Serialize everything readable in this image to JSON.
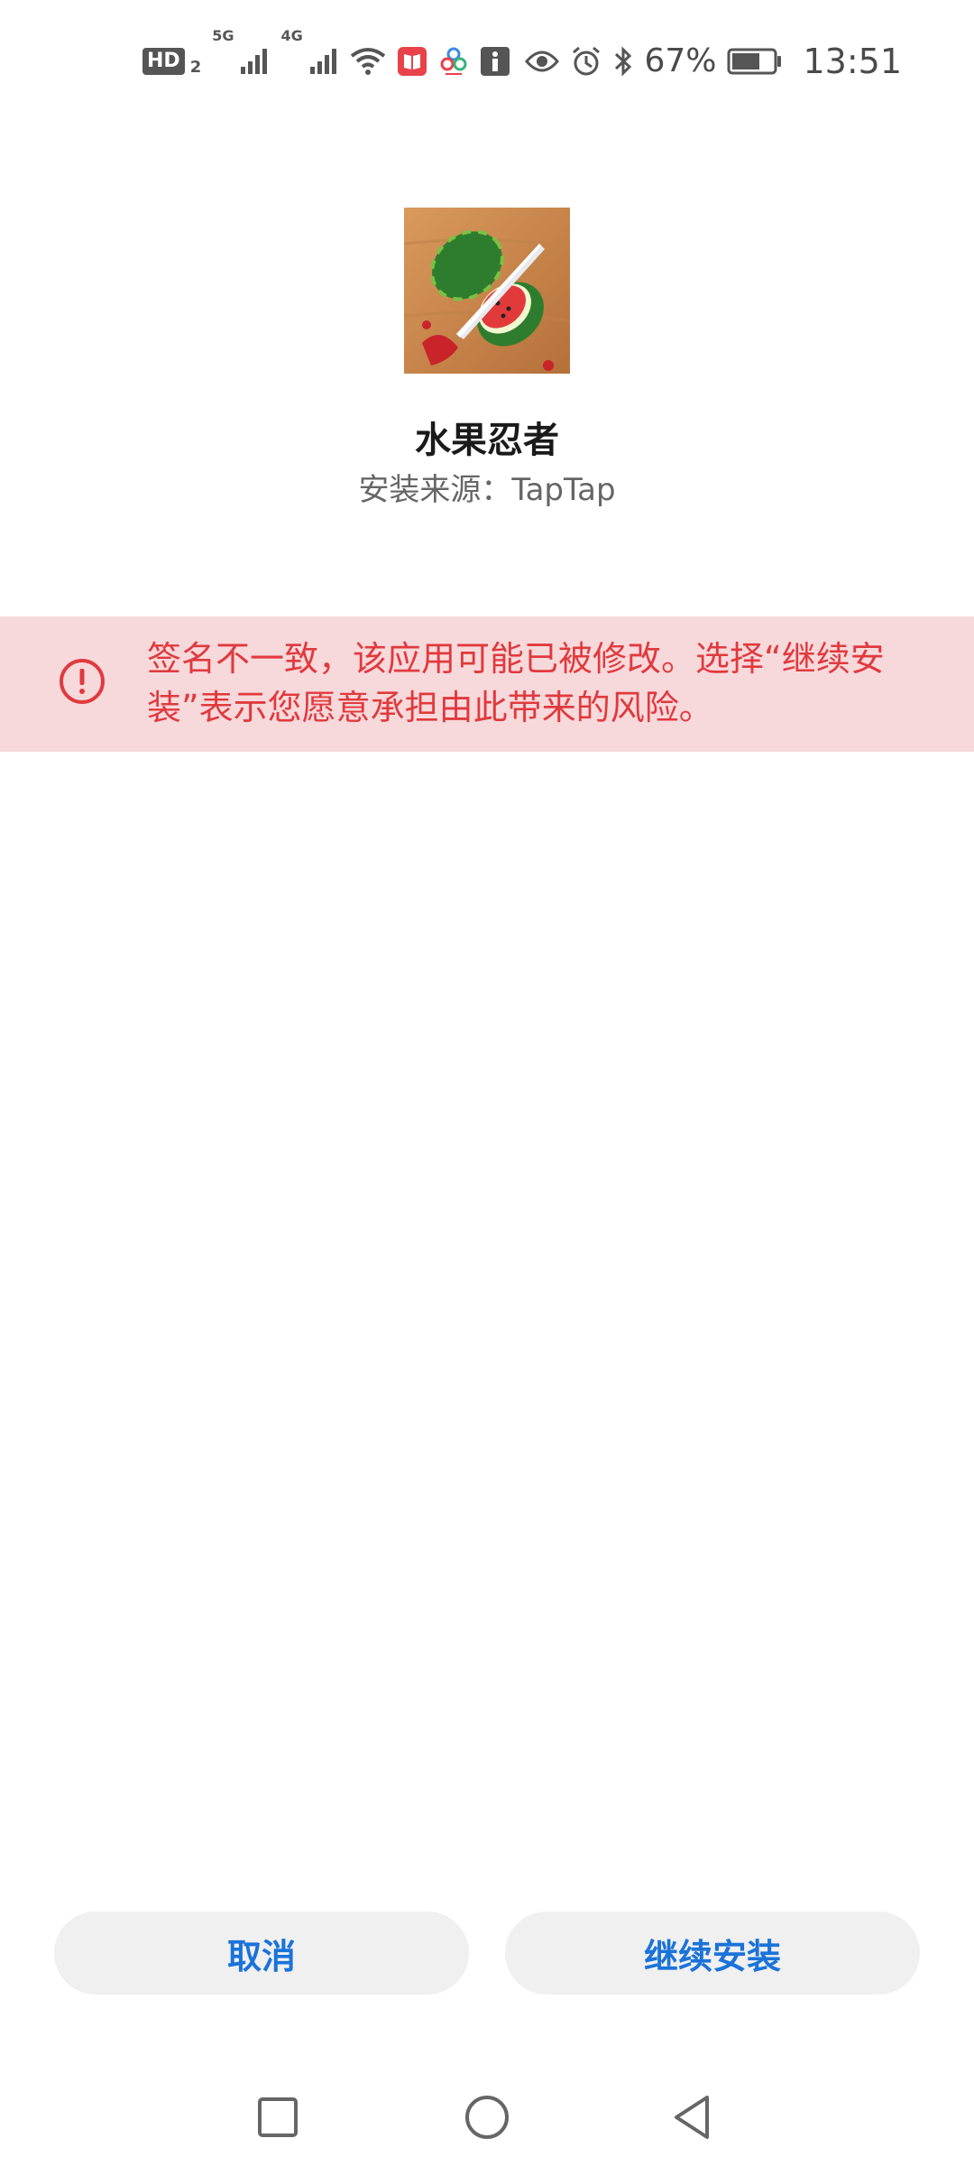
{
  "status_bar": {
    "hd_label": "HD",
    "sim_slot": "2",
    "net1": "5G",
    "net2": "4G",
    "battery_percent": "67%",
    "time": "13:51",
    "icons": [
      "hd-icon",
      "signal-5g-icon",
      "signal-4g-icon",
      "wifi-icon",
      "book-app-icon",
      "tri-dot-app-icon",
      "info-app-icon",
      "eye-icon",
      "alarm-icon",
      "bluetooth-icon",
      "battery-icon"
    ]
  },
  "app": {
    "icon": "fruit-ninja-watermelon-icon",
    "name": "水果忍者",
    "source": "安装来源：TapTap"
  },
  "warning": {
    "icon": "exclamation-circle-icon",
    "text": "签名不一致，该应用可能已被修改。选择“继续安装”表示您愿意承担由此带来的风险。",
    "color": "#e03a3e",
    "background": "#f8d9db"
  },
  "buttons": {
    "cancel": "取消",
    "continue": "继续安装",
    "accent": "#1a73d9"
  },
  "nav": {
    "icons": [
      "recent-apps-icon",
      "home-icon",
      "back-icon"
    ]
  }
}
